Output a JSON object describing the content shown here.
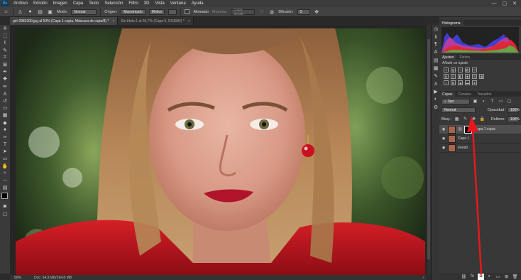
{
  "menubar": {
    "logo": "Ps",
    "items": [
      "Archivo",
      "Edición",
      "Imagen",
      "Capa",
      "Texto",
      "Selección",
      "Filtro",
      "3D",
      "Vista",
      "Ventana",
      "Ayuda"
    ],
    "window_controls": [
      "—",
      "▢",
      "✕"
    ]
  },
  "options": {
    "modo_label": "Modo:",
    "modo_value": "Normal",
    "origen_label": "Origen:",
    "origen_btn1": "Muestreado",
    "origen_btn2": "Motivo",
    "alineado_label": "Alineado",
    "muestra_label": "Muestra:",
    "muestra_value": "Capa actual",
    "difusion_label": "Difusión:",
    "difusion_value": "5"
  },
  "tabs": [
    {
      "label": "girl-2883300.jpg al 50% (Capa 1 copia, Máscara de capa/8) *",
      "active": true
    },
    {
      "label": "Sin título-1 al 66,7% (Capa 5, RGB/8#) *",
      "active": false
    }
  ],
  "status": {
    "zoom": "50%",
    "doc": "Doc: 34,9 MB/164,8 MB"
  },
  "panels": {
    "histogram_tab": "Histograma",
    "adjust_tabs": [
      "Ajustes",
      "Estilos"
    ],
    "adjust_hint": "Añadir un ajuste",
    "layer_tabs": [
      "Capas",
      "Canales",
      "Trazados"
    ],
    "filter_kind": "Tipo",
    "blend_mode": "Normal",
    "opacity_label": "Opacidad:",
    "opacity_value": "100%",
    "lock_label": "Bloq.:",
    "fill_label": "Relleno:",
    "fill_value": "100%",
    "layers": [
      {
        "name": "Capa 1 copia",
        "selected": true,
        "mask": true
      },
      {
        "name": "Capa 1",
        "selected": false,
        "mask": false
      },
      {
        "name": "Fondo",
        "selected": false,
        "mask": false
      }
    ]
  },
  "annotation": {
    "color": "#e8171b"
  }
}
